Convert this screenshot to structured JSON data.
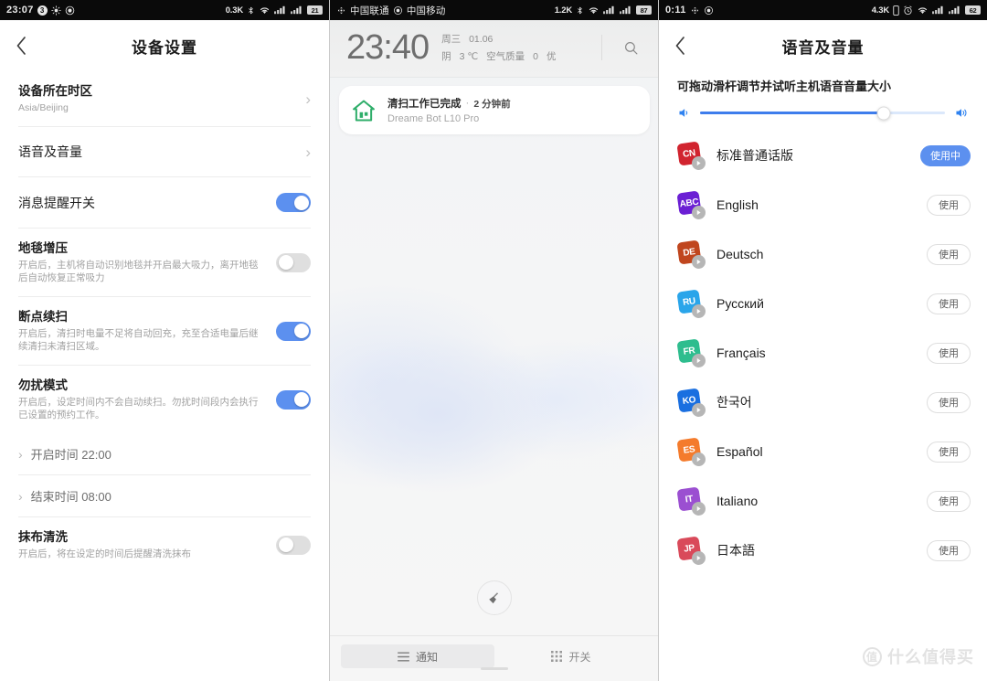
{
  "colors": {
    "accent_blue": "#5c90ef",
    "slider_blue": "#3e7dec",
    "toggle_off": "#dfdfdf",
    "statusbar_bg": "#0a0a0a",
    "notif_icon_green": "#2fae6a",
    "watermark": "#e2e2e2"
  },
  "panel_left": {
    "statusbar": {
      "time": "23:07",
      "badge_count": "3",
      "icons_left": [
        "brightness-icon",
        "record-icon"
      ],
      "data_rate": "0.3K",
      "icons_right": [
        "bluetooth-icon",
        "wifi-icon",
        "signal-icon",
        "signal-icon"
      ],
      "battery": "21"
    },
    "header": {
      "back": "‹",
      "title": "设备设置"
    },
    "rows": [
      {
        "title": "设备所在时区",
        "sub": "Asia/Beijing",
        "control": "chevron",
        "bold": true
      },
      {
        "title": "语音及音量",
        "sub": "",
        "control": "chevron",
        "bold": false
      },
      {
        "title": "消息提醒开关",
        "sub": "",
        "control": "toggle",
        "state": "on",
        "bold": false
      },
      {
        "title": "地毯增压",
        "sub": "开启后，主机将自动识别地毯并开启最大吸力，离开地毯后自动恢复正常吸力",
        "control": "toggle",
        "state": "off",
        "bold": true
      },
      {
        "title": "断点续扫",
        "sub": "开启后，清扫时电量不足将自动回充，充至合适电量后继续清扫未清扫区域。",
        "control": "toggle",
        "state": "on",
        "bold": true
      },
      {
        "title": "勿扰模式",
        "sub": "开启后，设定时间内不会自动续扫。勿扰时间段内会执行已设置的预约工作。",
        "control": "toggle",
        "state": "on",
        "bold": true
      }
    ],
    "time_rows": [
      {
        "label": "开启时间 22:00"
      },
      {
        "label": "结束时间 08:00"
      }
    ],
    "last_row": {
      "title": "抹布清洗",
      "sub": "开启后，将在设定的时间后提醒清洗抹布",
      "control": "toggle",
      "state": "off"
    }
  },
  "panel_middle": {
    "statusbar": {
      "carrier1": "中国联通",
      "carrier2": "中国移动",
      "data_rate": "1.2K",
      "battery": "87"
    },
    "clock": {
      "time": "23:40",
      "weekday": "周三",
      "date": "01.06",
      "condition": "阴",
      "temperature": "3 ℃",
      "aqi_label": "空气质量",
      "aqi_value": "0",
      "aqi_quality": "优",
      "search_icon": "search-icon"
    },
    "notification": {
      "icon": "home-icon",
      "title": "清扫工作已完成",
      "separator": "·",
      "time": "2 分钟前",
      "app": "Dreame Bot L10 Pro"
    },
    "fab": {
      "icon": "broom-icon"
    },
    "tabs": [
      {
        "label": "通知",
        "icon": "list-icon",
        "active": true
      },
      {
        "label": "开关",
        "icon": "grid-icon",
        "active": false
      }
    ]
  },
  "panel_right": {
    "statusbar": {
      "time": "0:11",
      "icons_left": [
        "bluetooth-icon",
        "record-icon"
      ],
      "data_rate": "4.3K",
      "icons_right": [
        "vibrate-icon",
        "alarm-icon",
        "wifi-icon",
        "signal-icon",
        "signal-icon"
      ],
      "battery": "62"
    },
    "header": {
      "back": "‹",
      "title": "语音及音量"
    },
    "hint": "可拖动滑杆调节并试听主机语音音量大小",
    "slider": {
      "value_percent": 75,
      "left_icon": "volume-low-icon",
      "right_icon": "volume-high-icon"
    },
    "languages": [
      {
        "code": "CN",
        "name": "标准普通话版",
        "color": "#d1242f",
        "button": "使用中",
        "active": true
      },
      {
        "code": "ABC",
        "name": "English",
        "color": "#6b1fd4",
        "button": "使用",
        "active": false
      },
      {
        "code": "DE",
        "name": "Deutsch",
        "color": "#c0461e",
        "button": "使用",
        "active": false
      },
      {
        "code": "RU",
        "name": "Русский",
        "color": "#2aa5ea",
        "button": "使用",
        "active": false
      },
      {
        "code": "FR",
        "name": "Français",
        "color": "#2ebd8e",
        "button": "使用",
        "active": false
      },
      {
        "code": "KO",
        "name": "한국어",
        "color": "#1a6fe0",
        "button": "使用",
        "active": false
      },
      {
        "code": "ES",
        "name": "Español",
        "color": "#f47b2c",
        "button": "使用",
        "active": false
      },
      {
        "code": "IT",
        "name": "Italiano",
        "color": "#9b4fd1",
        "button": "使用",
        "active": false
      },
      {
        "code": "JP",
        "name": "日本語",
        "color": "#d94a5a",
        "button": "使用",
        "active": false
      }
    ]
  },
  "watermark": {
    "mark": "值",
    "text": "什么值得买"
  }
}
